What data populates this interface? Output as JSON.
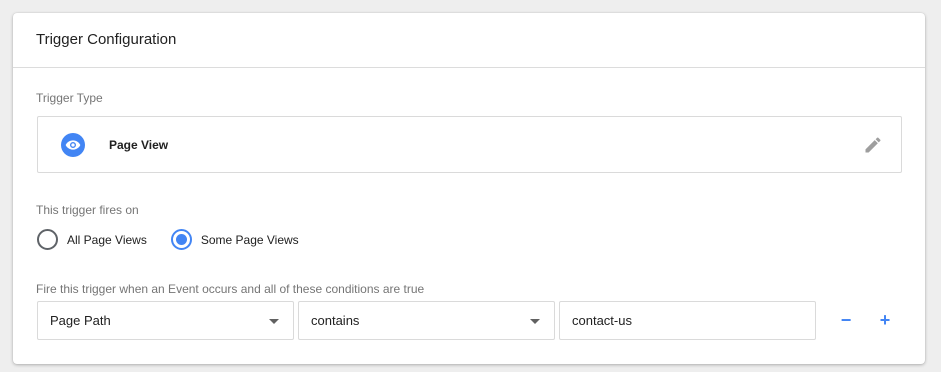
{
  "card": {
    "title": "Trigger Configuration"
  },
  "trigger_type": {
    "label": "Trigger Type",
    "name": "Page View",
    "icon": "eye-icon",
    "accent_color": "#4285f4"
  },
  "fires_on": {
    "label": "This trigger fires on",
    "options": [
      {
        "label": "All Page Views",
        "selected": false
      },
      {
        "label": "Some Page Views",
        "selected": true
      }
    ]
  },
  "condition": {
    "label": "Fire this trigger when an Event occurs and all of these conditions are true",
    "variable": "Page Path",
    "operator": "contains",
    "value": "contact-us",
    "remove_label": "−",
    "add_label": "+"
  }
}
